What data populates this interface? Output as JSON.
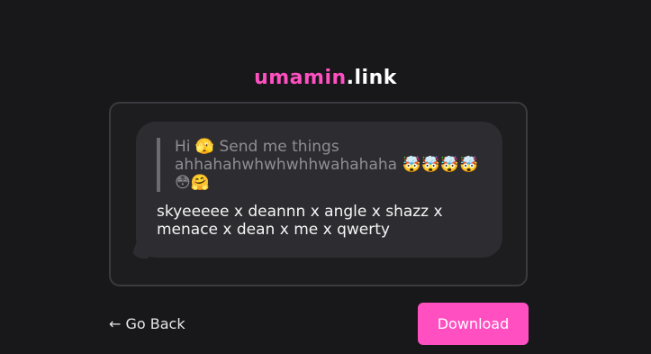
{
  "logo": {
    "brand": "umamin",
    "tld": ".link"
  },
  "card": {
    "quote": "Hi 🫣 Send me things ahhahahwhwhwhhwahahaha 🤯🤯🤯🤯😳🤗",
    "message": "skyeeeee x deannn x angle x shazz x\nmenace x dean x me x qwerty"
  },
  "actions": {
    "back_label": "← Go Back",
    "download_label": "Download"
  },
  "colors": {
    "accent": "#ff4fc1",
    "background": "#18181b",
    "bubble": "#2c2c31"
  }
}
